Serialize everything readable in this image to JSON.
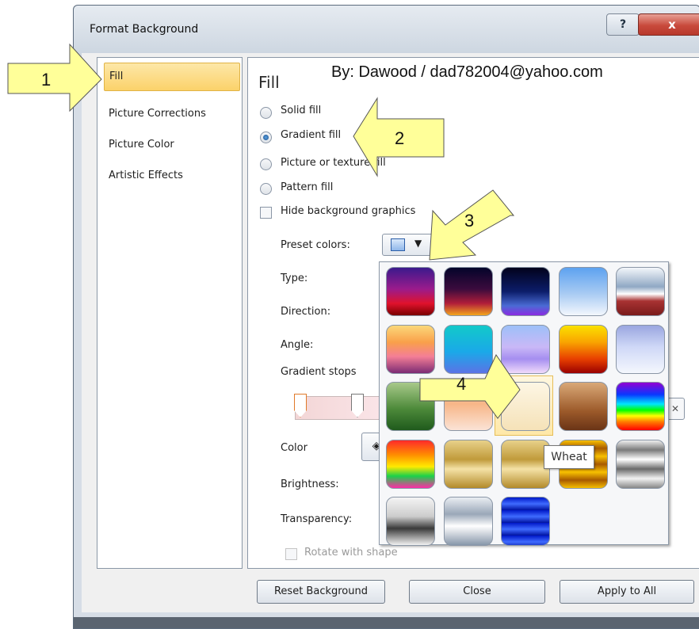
{
  "dialog": {
    "title": "Format Background",
    "help_label": "?",
    "close_label": "x"
  },
  "nav": {
    "items": [
      {
        "label": "Fill",
        "selected": true
      },
      {
        "label": "Picture Corrections"
      },
      {
        "label": "Picture Color"
      },
      {
        "label": "Artistic Effects"
      }
    ]
  },
  "panel": {
    "title": "Fill",
    "credit": "By: Dawood / dad782004@yahoo.com",
    "fill_options": [
      {
        "label": "Solid fill",
        "checked": false
      },
      {
        "label": "Gradient fill",
        "checked": true
      },
      {
        "label": "Picture or texture fill",
        "checked": false
      },
      {
        "label": "Pattern fill",
        "checked": false
      }
    ],
    "hide_background_label": "Hide background graphics",
    "preset_colors_label": "Preset colors:",
    "type_label": "Type:",
    "direction_label": "Direction:",
    "angle_label": "Angle:",
    "gradient_stops_label": "Gradient stops",
    "color_label": "Color",
    "brightness_label": "Brightness:",
    "transparency_label": "Transparency:",
    "rotate_label": "Rotate with shape"
  },
  "gallery": {
    "tooltip": "Wheat",
    "selected_index": 11
  },
  "footer": {
    "reset": "Reset Background",
    "close": "Close",
    "apply": "Apply to All"
  },
  "annotations": [
    "1",
    "2",
    "3",
    "4"
  ],
  "colors": {
    "callout_fill": "#ffff99",
    "nav_selected": "#fbd26a",
    "title_close": "#c84a3c"
  }
}
